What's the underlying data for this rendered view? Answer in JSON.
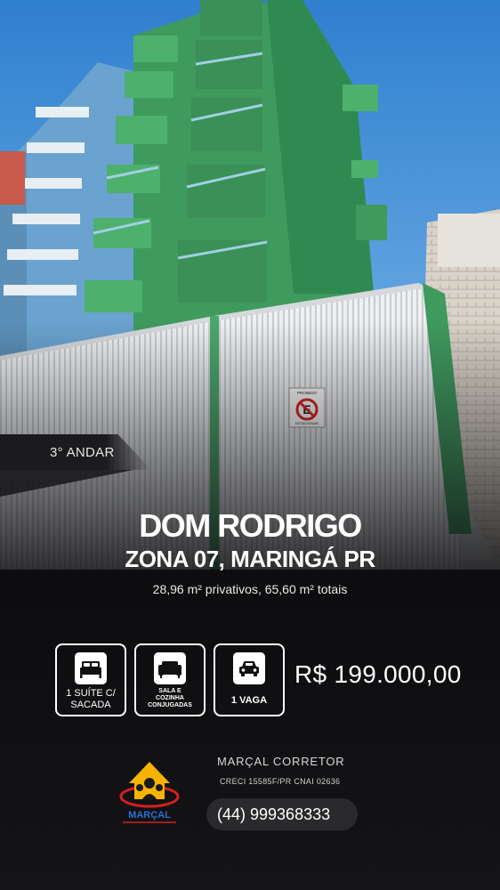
{
  "floor_tag": "3° ANDAR",
  "title": "DOM RODRIGO",
  "subtitle": "ZONA 07, MARINGÁ PR",
  "area_text": "28,96 m² privativos, 65,60 m² totais",
  "features": [
    {
      "icon": "bed-icon",
      "label_line1": "1 SUÍTE C/",
      "label_line2": "SACADA"
    },
    {
      "icon": "sofa-icon",
      "label_line1": "SALA E",
      "label_line2": "COZINHA",
      "label_line3": "CONJUGADAS"
    },
    {
      "icon": "car-icon",
      "label_line1": "1 VAGA"
    }
  ],
  "price": "R$ 199.000,00",
  "agent": {
    "name": "MARÇAL CORRETOR",
    "creci": "CRECI 15585F/PR CNAI 02636",
    "phone": "(44) 999368333",
    "logo_text": "MARÇAL"
  },
  "sign_text_top": "PROIBIDO",
  "sign_text_bottom": "ESTACIONAR",
  "colors": {
    "sky": "#3f8ed6",
    "building_green": "#3f9a5e",
    "building_blue": "#6fa9d6",
    "gate": "#e9ecef",
    "background": "#0d0d0f"
  }
}
